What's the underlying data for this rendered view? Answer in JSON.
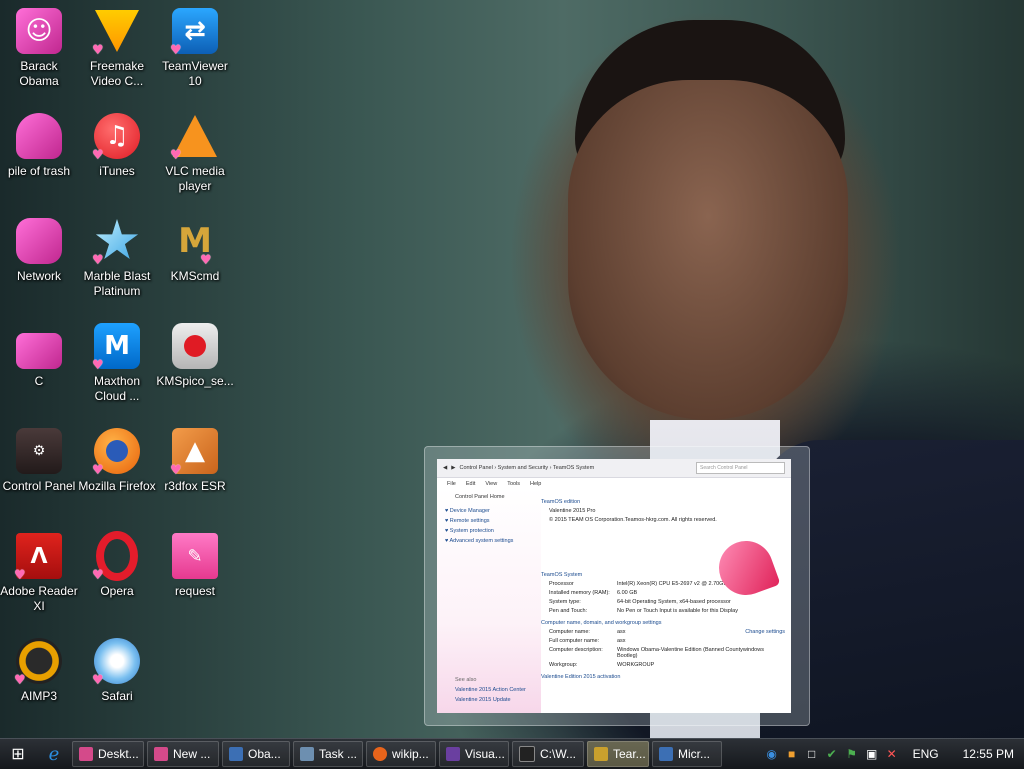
{
  "desktop_icons": [
    {
      "label": "Barack Obama",
      "icon": "barack-obama-icon"
    },
    {
      "label": "Freemake Video C...",
      "icon": "freemake-icon"
    },
    {
      "label": "TeamViewer 10",
      "icon": "teamviewer-icon"
    },
    {
      "label": "pile of trash",
      "icon": "recycle-bin-icon"
    },
    {
      "label": "iTunes",
      "icon": "itunes-icon"
    },
    {
      "label": "VLC media player",
      "icon": "vlc-icon"
    },
    {
      "label": "Network",
      "icon": "network-icon"
    },
    {
      "label": "Marble Blast Platinum",
      "icon": "marble-blast-icon"
    },
    {
      "label": "KMScmd",
      "icon": "kmscmd-icon"
    },
    {
      "label": "C",
      "icon": "drive-c-icon"
    },
    {
      "label": "Maxthon Cloud ...",
      "icon": "maxthon-icon"
    },
    {
      "label": "KMSpico_se...",
      "icon": "kmspico-icon"
    },
    {
      "label": "Control Panel",
      "icon": "control-panel-icon"
    },
    {
      "label": "Mozilla Firefox",
      "icon": "firefox-icon"
    },
    {
      "label": "r3dfox ESR",
      "icon": "r3dfox-icon"
    },
    {
      "label": "Adobe Reader XI",
      "icon": "adobe-reader-icon"
    },
    {
      "label": "Opera",
      "icon": "opera-icon"
    },
    {
      "label": "request",
      "icon": "notebook-icon"
    },
    {
      "label": "AIMP3",
      "icon": "aimp-icon"
    },
    {
      "label": "Safari",
      "icon": "safari-icon"
    }
  ],
  "control_panel_preview": {
    "breadcrumb": "Control Panel  ›  System and Security  ›  TeamOS System",
    "search_placeholder": "Search Control Panel",
    "menu": [
      "File",
      "Edit",
      "View",
      "Tools",
      "Help"
    ],
    "left_heading": "Control Panel Home",
    "left_links": [
      "Device Manager",
      "Remote settings",
      "System protection",
      "Advanced system settings"
    ],
    "left_bottom": [
      "See also",
      "Valentine 2015 Action Center",
      "Valentine 2015 Update"
    ],
    "edition_title": "TeamOS edition",
    "edition_name": "Valentine 2015 Pro",
    "copyright": "© 2015 TEAM OS Corporation.Teamos-hkrg.com. All rights reserved.",
    "system_title": "TeamOS System",
    "system_rows": [
      {
        "k": "Processor",
        "v": "Intel(R) Xeon(R) CPU E5-2697 v2 @ 2.70GHz   2.70 GHz"
      },
      {
        "k": "Installed memory (RAM):",
        "v": "6.00 GB"
      },
      {
        "k": "System type:",
        "v": "64-bit Operating System, x64-based processor"
      },
      {
        "k": "Pen and Touch:",
        "v": "No Pen or Touch Input is available for this Display"
      }
    ],
    "computer_title": "Computer name, domain, and workgroup settings",
    "change_settings": "Change settings",
    "computer_rows": [
      {
        "k": "Computer name:",
        "v": "asx"
      },
      {
        "k": "Full computer name:",
        "v": "asx"
      },
      {
        "k": "Computer description:",
        "v": "Windows Obama-Valentine Edition (Banned Countywindows Bootleg)"
      },
      {
        "k": "Workgroup:",
        "v": "WORKGROUP"
      }
    ],
    "activation_title": "Valentine Edition 2015 activation"
  },
  "taskbar": {
    "tasks": [
      {
        "label": "Deskt...",
        "color": "#d44a8a"
      },
      {
        "label": "New ...",
        "color": "#d44a8a"
      },
      {
        "label": "Oba...",
        "color": "#3c6fb4"
      },
      {
        "label": "Task ...",
        "color": "#6d8fb0"
      },
      {
        "label": "wikip...",
        "color": "#e8641b"
      },
      {
        "label": "Visua...",
        "color": "#6a3fa0"
      },
      {
        "label": "C:\\W...",
        "color": "#222222"
      },
      {
        "label": "Tear...",
        "color": "#c9a02d"
      },
      {
        "label": "Micr...",
        "color": "#3c6fb4"
      }
    ],
    "language": "ENG",
    "clock": "12:55 PM"
  },
  "colors": {
    "taskbar": "#15181c",
    "link": "#1a4a8e",
    "heart": "#ff69b4"
  }
}
